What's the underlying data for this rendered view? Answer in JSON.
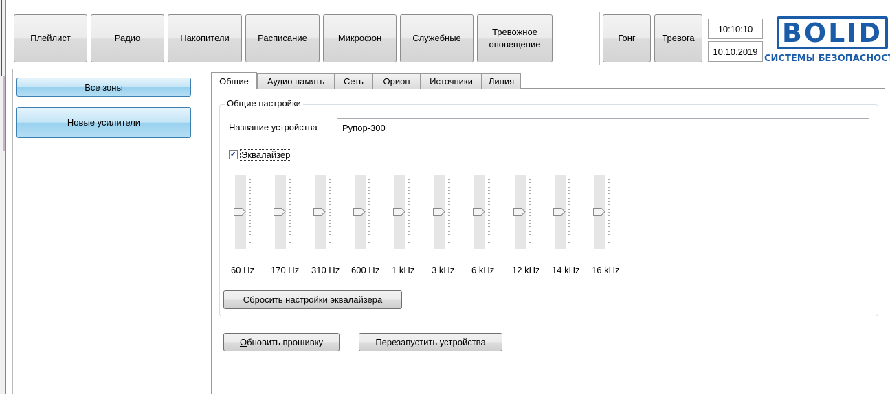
{
  "toolbar": {
    "playlist": "Плейлист",
    "radio": "Радио",
    "storage": "Накопители",
    "schedule": "Расписание",
    "microphone": "Микрофон",
    "service": "Служебные",
    "alarm_notify": "Тревожное\nоповещение",
    "gong": "Гонг",
    "alarm": "Тревога"
  },
  "clock": {
    "time": "10:10:10",
    "date": "10.10.2019"
  },
  "logo": {
    "brand": "BOLID",
    "subtitle": "СИСТЕМЫ БЕЗОПАСНОСТИ"
  },
  "zones": {
    "all": "Все зоны",
    "new_amps": "Новые усилители"
  },
  "tabs": [
    "Общие",
    "Аудио память",
    "Сеть",
    "Орион",
    "Источники",
    "Линия"
  ],
  "general": {
    "group_title": "Общие настройки",
    "device_name_label": "Название устройства",
    "device_name_value": "Рупор-300",
    "equalizer_label": "Эквалайзер",
    "equalizer_checked": true,
    "bands": [
      "60 Hz",
      "170 Hz",
      "310 Hz",
      "600 Hz",
      "1 kHz",
      "3 kHz",
      "6 kHz",
      "12 kHz",
      "14 kHz",
      "16 kHz"
    ],
    "band_levels": [
      0.5,
      0.5,
      0.5,
      0.5,
      0.5,
      0.5,
      0.5,
      0.5,
      0.5,
      0.5
    ],
    "reset_eq_button": "Сбросить настройки эквалайзера",
    "update_fw_first": "О",
    "update_fw_rest": "бновить прошивку",
    "restart_devices": "Перезапустить устройства"
  }
}
